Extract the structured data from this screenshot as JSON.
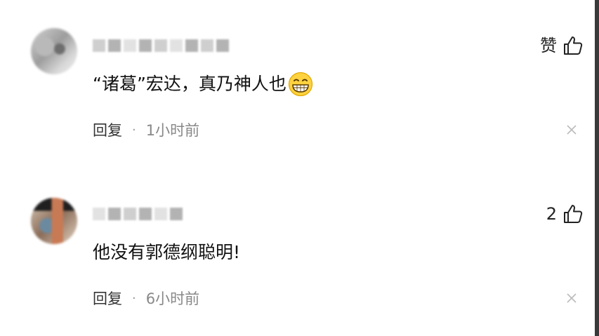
{
  "comments": [
    {
      "like_label": "赞",
      "content_text": "“诸葛”宏达，真乃神人也",
      "reply_label": "回复",
      "separator": "·",
      "time": "1小时前"
    },
    {
      "like_label": "2",
      "content_text": "他没有郭德纲聪明!",
      "reply_label": "回复",
      "separator": "·",
      "time": "6小时前"
    }
  ],
  "icons": {
    "like": "thumbs-up-icon",
    "emoji": "grinning-emoji",
    "dismiss": "close-icon"
  }
}
